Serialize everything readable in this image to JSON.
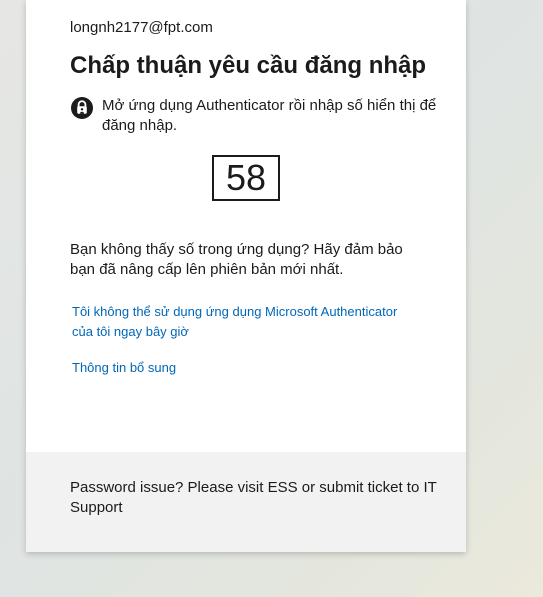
{
  "identity": {
    "email": "longnh2177@fpt.com"
  },
  "approve": {
    "title": "Chấp thuận yêu cầu đăng nhập",
    "icon": "authenticator-lock-icon",
    "instruction": "Mở ứng dụng Authenticator rồi nhập số hiển thị để đăng nhập.",
    "number": "58",
    "hint": "Bạn không thấy số trong ứng dụng? Hãy đảm bảo bạn đã nâng cấp lên phiên bản mới nhất.",
    "link_cannot_use": "Tôi không thể sử dụng ứng dụng Microsoft Authenticator của tôi ngay bây giờ",
    "link_more_info": "Thông tin bổ sung"
  },
  "footer": {
    "text": "Password issue? Please visit ESS or submit ticket to IT Support"
  },
  "colors": {
    "link": "#0067b8",
    "text": "#1b1b1b",
    "footer_bg": "#f2f2f2"
  }
}
